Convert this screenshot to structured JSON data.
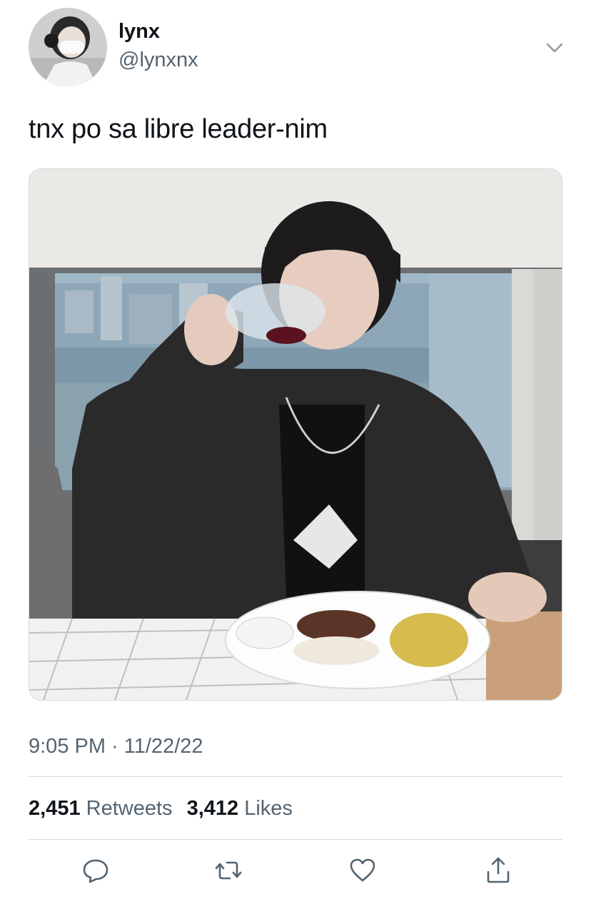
{
  "author": {
    "display_name": "lynx",
    "handle": "@lynxnx"
  },
  "tweet": {
    "text": "tnx po sa libre leader-nim",
    "timestamp": "9:05 PM · 11/22/22"
  },
  "stats": {
    "retweets_count": "2,451",
    "retweets_label": "Retweets",
    "likes_count": "3,412",
    "likes_label": "Likes"
  },
  "icons": {
    "menu": "chevron-down-icon",
    "reply": "reply-icon",
    "retweet": "retweet-icon",
    "like": "heart-icon",
    "share": "share-icon"
  },
  "colors": {
    "text": "#0f1419",
    "secondary": "#536471",
    "divider": "#cfd9de"
  }
}
